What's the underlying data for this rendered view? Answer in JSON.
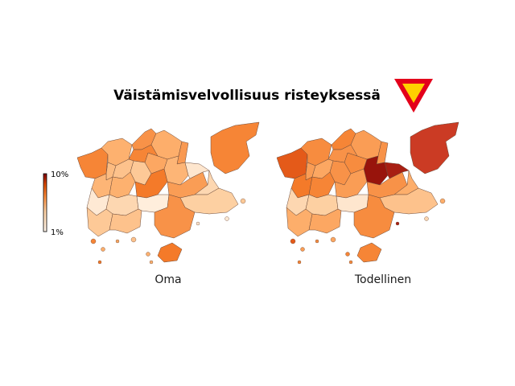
{
  "title": "Väistämisvelvollisuus risteyksessä",
  "sign_icon": "yield-sign-icon",
  "colors": {
    "sign_border": "#e3001b",
    "sign_fill": "#ffd000",
    "scale_low": "#fff5eb",
    "scale_mid": "#fdae6b",
    "scale_high": "#7f0000",
    "map_outline": "#6b4a3a"
  },
  "colorbar": {
    "max_label": "10%",
    "min_label": "1%"
  },
  "maps": [
    {
      "label": "Oma",
      "regions": [
        {
          "shade": 0.62
        },
        {
          "shade": 0.48
        },
        {
          "shade": 0.58
        },
        {
          "shade": 0.5
        },
        {
          "shade": 0.56
        },
        {
          "shade": 0.45
        },
        {
          "shade": 0.52
        },
        {
          "shade": 0.62
        },
        {
          "shade": 0.4
        },
        {
          "shade": 0.35
        },
        {
          "shade": 0.3
        },
        {
          "shade": 0.45
        },
        {
          "shade": 0.48
        },
        {
          "shade": 0.65
        },
        {
          "shade": 0.55
        },
        {
          "shade": 0.1
        },
        {
          "shade": 0.2
        },
        {
          "shade": 0.25
        },
        {
          "shade": 0.08
        },
        {
          "shade": 0.2
        },
        {
          "shade": 0.05
        },
        {
          "shade": 0.3
        },
        {
          "shade": 0.35
        },
        {
          "shade": 0.58
        },
        {
          "shade": 0.65
        },
        {
          "shade": 0.62
        }
      ]
    },
    {
      "label": "Todellinen",
      "regions": [
        {
          "shade": 0.75
        },
        {
          "shade": 0.6
        },
        {
          "shade": 0.62
        },
        {
          "shade": 0.55
        },
        {
          "shade": 0.58
        },
        {
          "shade": 0.95
        },
        {
          "shade": 0.6
        },
        {
          "shade": 0.58
        },
        {
          "shade": 0.55
        },
        {
          "shade": 0.52
        },
        {
          "shade": 0.58
        },
        {
          "shade": 0.65
        },
        {
          "shade": 0.62
        },
        {
          "shade": 0.55
        },
        {
          "shade": 0.58
        },
        {
          "shade": 0.92
        },
        {
          "shade": 0.5
        },
        {
          "shade": 0.35
        },
        {
          "shade": 0.2
        },
        {
          "shade": 0.25
        },
        {
          "shade": 0.1
        },
        {
          "shade": 0.5
        },
        {
          "shade": 0.52
        },
        {
          "shade": 0.6
        },
        {
          "shade": 0.62
        },
        {
          "shade": 0.85
        }
      ]
    }
  ]
}
